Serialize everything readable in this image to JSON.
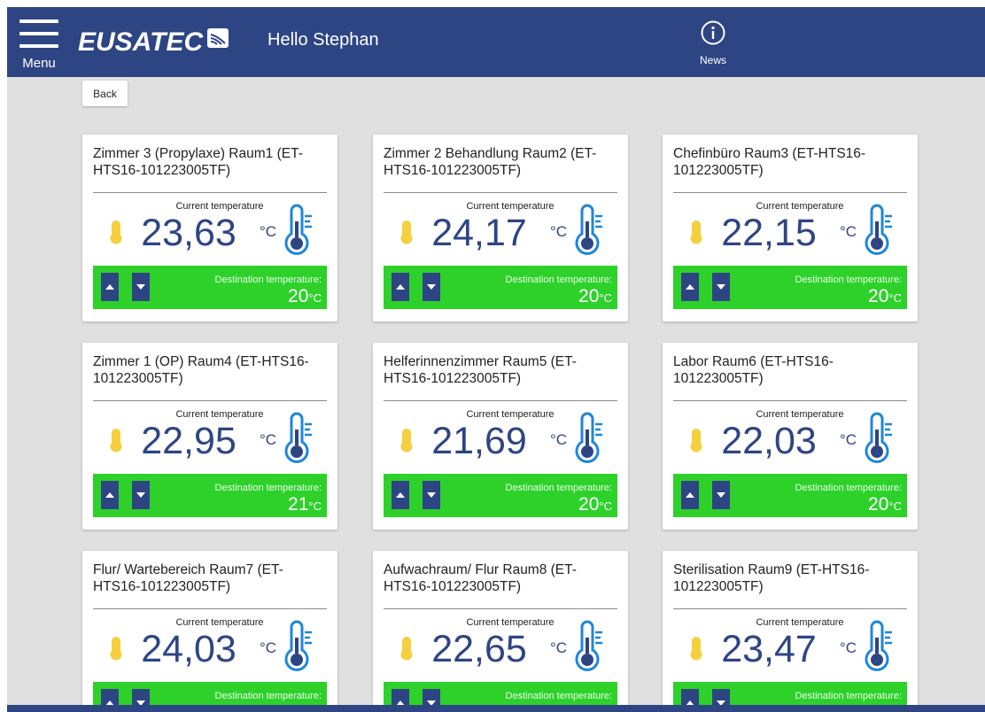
{
  "header": {
    "menu_label": "Menu",
    "logo_text": "EUSATEC",
    "greeting": "Hello Stephan",
    "news_label": "News"
  },
  "back_label": "Back",
  "labels": {
    "current_temperature": "Current temperature",
    "destination_temperature": "Destination temperature:",
    "unit": "°C"
  },
  "colors": {
    "navbar": "#2e4584",
    "destination_bar": "#2ed12a",
    "temperature_text": "#2e4584",
    "background": "#e0e0e0"
  },
  "rooms": [
    {
      "name": "Zimmer 3 (Propylaxe) Raum1 (ET-HTS16-101223005TF)",
      "current": "23,63",
      "destination": "20"
    },
    {
      "name": "Zimmer 2 Behandlung Raum2 (ET-HTS16-101223005TF)",
      "current": "24,17",
      "destination": "20"
    },
    {
      "name": "Chefinbüro Raum3 (ET-HTS16-101223005TF)",
      "current": "22,15",
      "destination": "20"
    },
    {
      "name": "Zimmer 1 (OP) Raum4 (ET-HTS16-101223005TF)",
      "current": "22,95",
      "destination": "21"
    },
    {
      "name": "Helferinnenzimmer Raum5 (ET-HTS16-101223005TF)",
      "current": "21,69",
      "destination": "20"
    },
    {
      "name": "Labor Raum6 (ET-HTS16-101223005TF)",
      "current": "22,03",
      "destination": "20"
    },
    {
      "name": "Flur/ Wartebereich Raum7 (ET-HTS16-101223005TF)",
      "current": "24,03",
      "destination": ""
    },
    {
      "name": "Aufwachraum/ Flur Raum8 (ET-HTS16-101223005TF)",
      "current": "22,65",
      "destination": ""
    },
    {
      "name": "Sterilisation Raum9 (ET-HTS16-101223005TF)",
      "current": "23,47",
      "destination": ""
    }
  ]
}
